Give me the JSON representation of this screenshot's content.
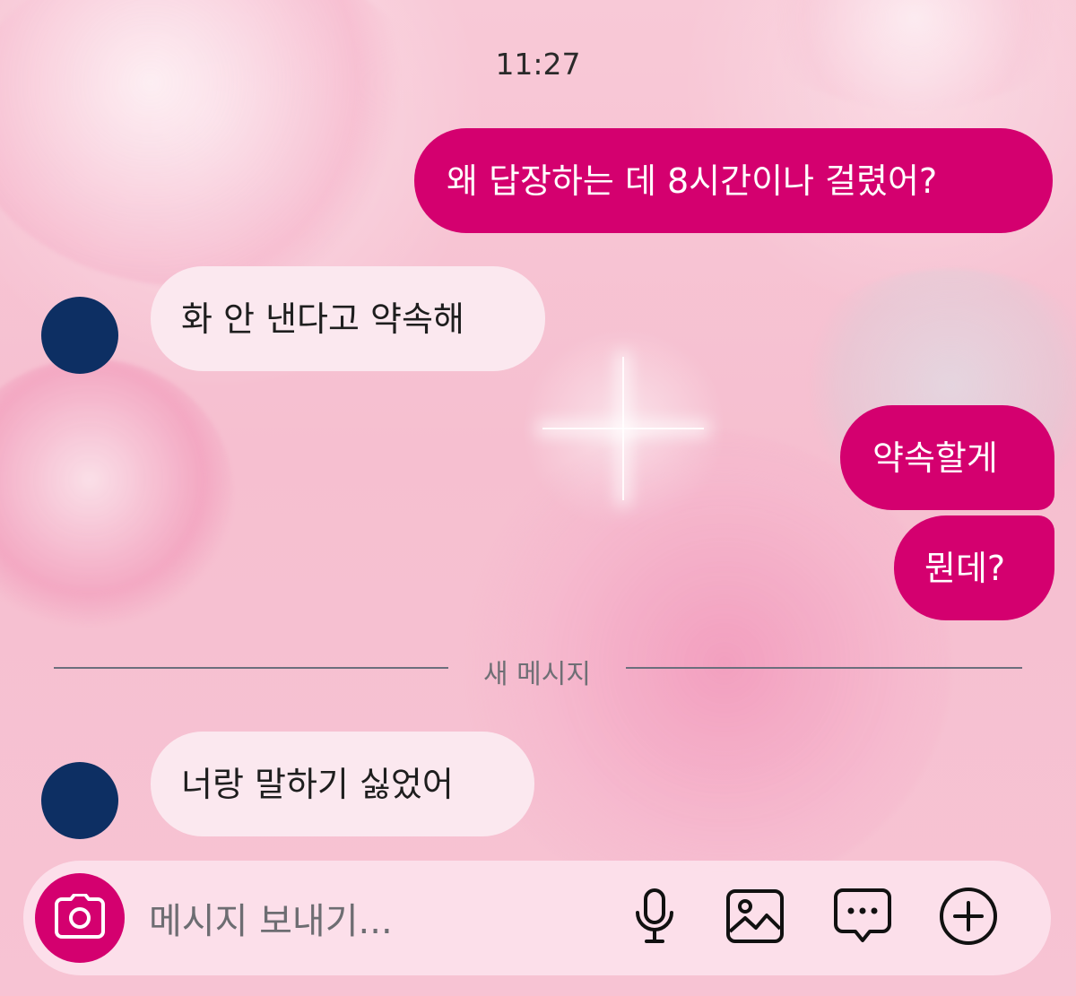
{
  "status_time": "11:27",
  "messages": [
    {
      "direction": "outgoing",
      "text": "왜 답장하는 데 8시간이나 걸렸어?"
    },
    {
      "direction": "incoming",
      "text": "화 안 낸다고 약속해"
    },
    {
      "direction": "outgoing",
      "text": "약속할게"
    },
    {
      "direction": "outgoing",
      "text": "뭔데?"
    },
    {
      "direction": "incoming",
      "text": "너랑 말하기 싫었어"
    }
  ],
  "divider": {
    "label": "새 메시지"
  },
  "composer": {
    "placeholder": "메시지 보내기...",
    "icons": [
      "camera-icon",
      "microphone-icon",
      "gallery-icon",
      "sticker-chat-icon",
      "plus-icon"
    ]
  },
  "colors": {
    "outgoing_bubble": "#d4006f",
    "incoming_bubble": "#fbe8ef",
    "avatar": "#0d2f63",
    "camera_button": "#d4006f"
  }
}
